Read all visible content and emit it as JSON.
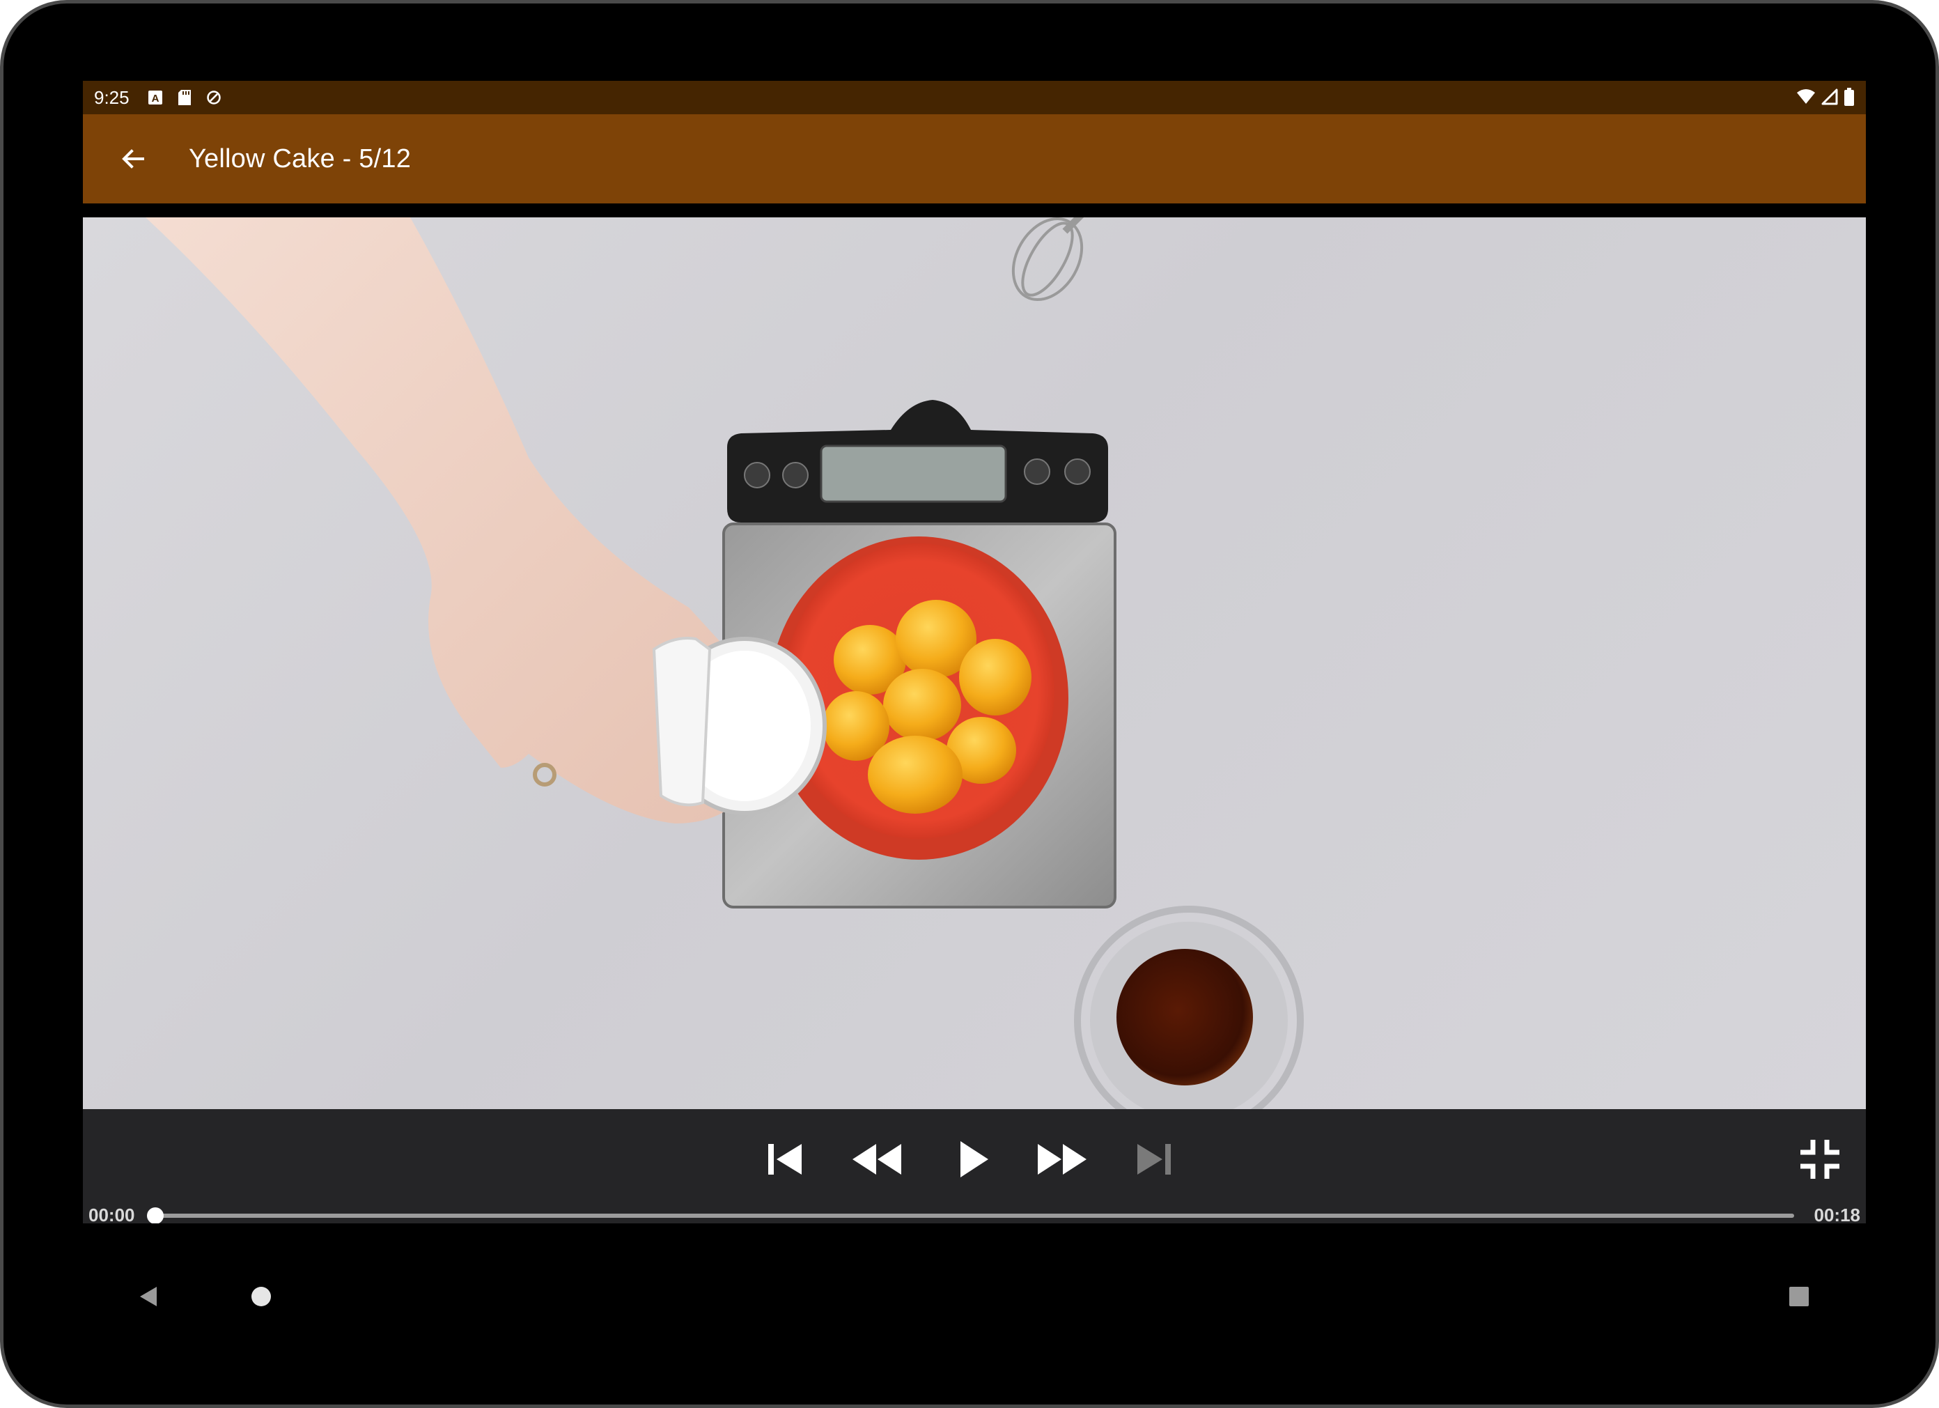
{
  "status_bar": {
    "time": "9:25",
    "left_icons": [
      "keyboard-a-icon",
      "sd-card-icon",
      "sync-icon"
    ],
    "right_icons": [
      "wifi-icon",
      "signal-icon",
      "battery-icon"
    ],
    "background_color": "#452501"
  },
  "app_bar": {
    "title": "Yellow Cake - 5/12",
    "back_icon": "arrow-back-icon",
    "background_color": "#7e4307"
  },
  "video": {
    "description_icon": "video-frame"
  },
  "player": {
    "buttons": [
      "skip-previous-icon",
      "rewind-icon",
      "play-icon",
      "fast-forward-icon",
      "skip-next-icon"
    ],
    "skip_next_enabled": false,
    "fullscreen_icon": "fullscreen-exit-icon",
    "position": "00:00",
    "duration": "00:18",
    "progress_fraction": 0.0
  },
  "nav_bar": {
    "buttons": [
      "back-nav-icon",
      "home-nav-icon",
      "recents-nav-icon"
    ]
  }
}
